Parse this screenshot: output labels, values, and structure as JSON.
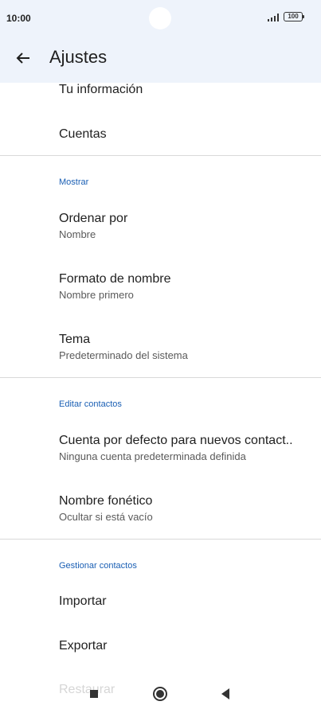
{
  "status": {
    "time": "10:00",
    "battery": "100",
    "signal_icon": "signal-icon"
  },
  "header": {
    "title": "Ajustes",
    "back_icon": "arrow-back-icon"
  },
  "items": {
    "tu_informacion": "Tu información",
    "cuentas": "Cuentas",
    "section_mostrar": "Mostrar",
    "ordenar_por": {
      "title": "Ordenar por",
      "sub": "Nombre"
    },
    "formato_nombre": {
      "title": "Formato de nombre",
      "sub": "Nombre primero"
    },
    "tema": {
      "title": "Tema",
      "sub": "Predeterminado del sistema"
    },
    "section_editar": "Editar contactos",
    "cuenta_defecto": {
      "title": "Cuenta por defecto para nuevos contact..",
      "sub": "Ninguna cuenta predeterminada definida"
    },
    "nombre_fonetico": {
      "title": "Nombre fonético",
      "sub": "Ocultar si está vacío"
    },
    "section_gestionar": "Gestionar contactos",
    "importar": "Importar",
    "exportar": "Exportar",
    "restaurar": "Restaurar"
  },
  "colors": {
    "header_bg": "#eef3fb",
    "accent": "#1a5fb4"
  }
}
